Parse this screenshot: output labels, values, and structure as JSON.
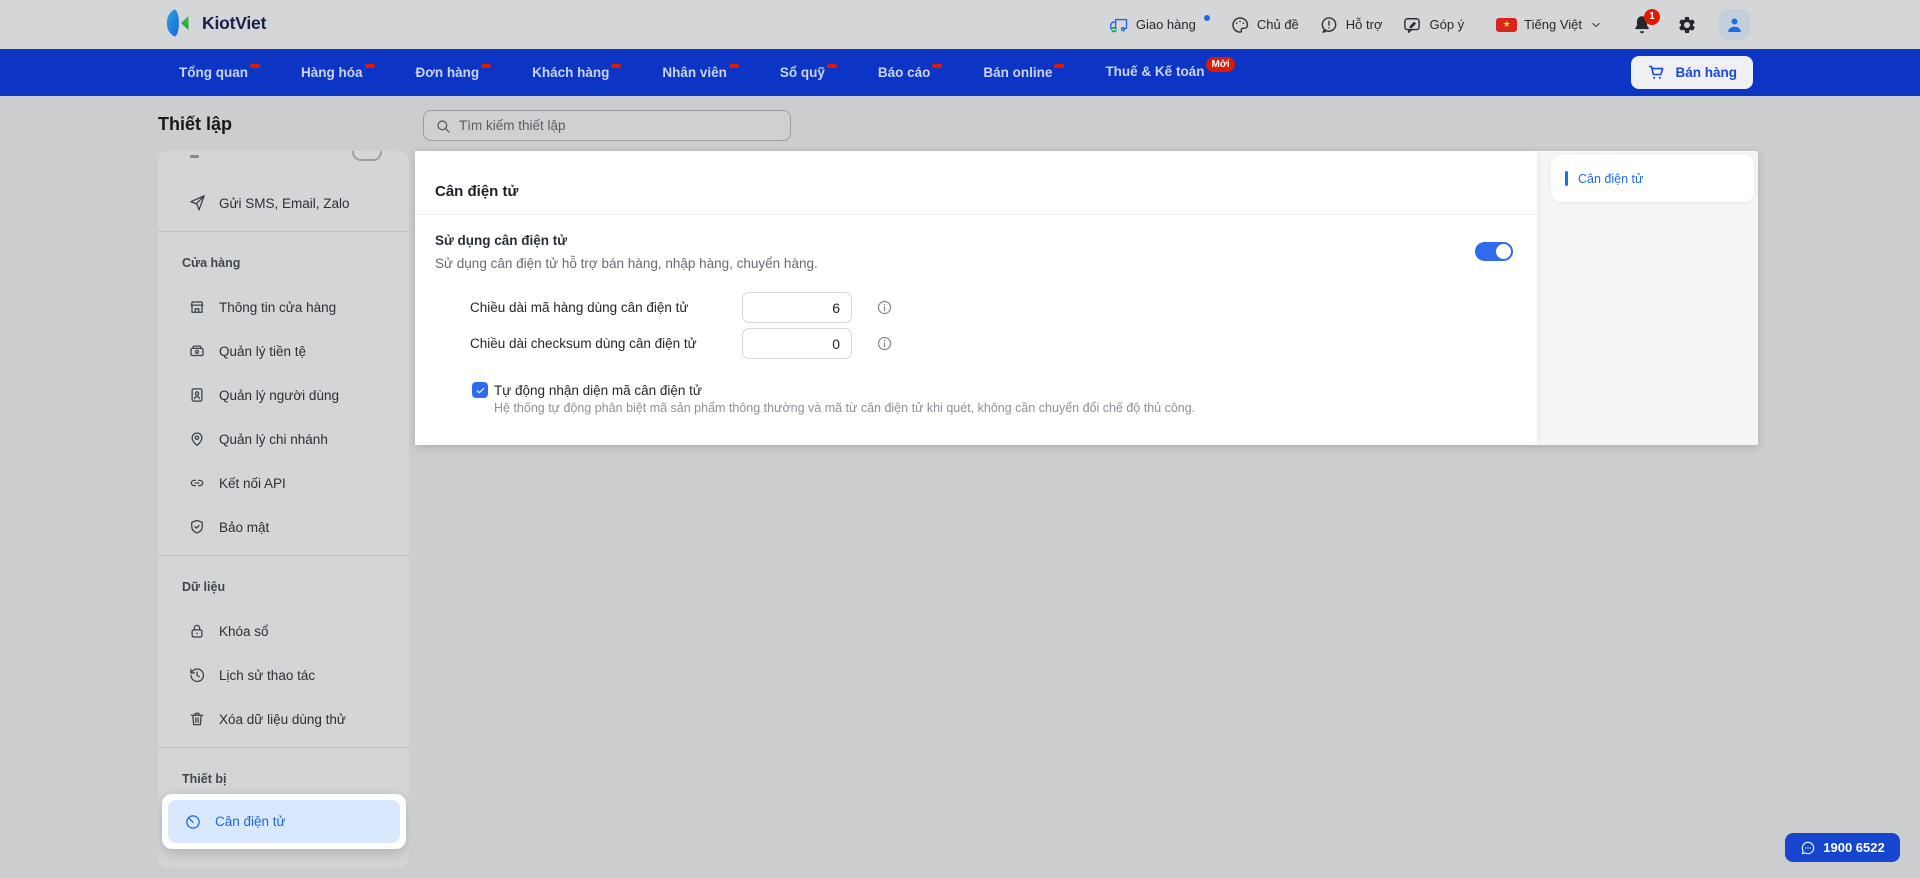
{
  "colors": {
    "nav_blue": "#0c35c5",
    "accent_blue": "#1f6be8",
    "badge_red": "#e11900",
    "selected_item_bg": "#d9e8fc",
    "page_bg": "#cbcdce"
  },
  "topbar": {
    "brand": "KiotViet",
    "items": [
      {
        "label": "Giao hàng",
        "icon": "delivery-truck",
        "dot": true
      },
      {
        "label": "Chủ đề",
        "icon": "palette"
      },
      {
        "label": "Hỗ trợ",
        "icon": "help-bubble"
      },
      {
        "label": "Góp ý",
        "icon": "feedback-bubble"
      }
    ],
    "language": {
      "label": "Tiếng Việt",
      "flag": "vietnam-flag",
      "star": "★"
    },
    "notifications": {
      "count": "1"
    }
  },
  "navbar": {
    "items": [
      {
        "label": "Tổng quan"
      },
      {
        "label": "Hàng hóa"
      },
      {
        "label": "Đơn hàng"
      },
      {
        "label": "Khách hàng"
      },
      {
        "label": "Nhân viên"
      },
      {
        "label": "Sổ quỹ"
      },
      {
        "label": "Báo cáo"
      },
      {
        "label": "Bán online"
      },
      {
        "label": "Thuế & Kế toán",
        "badge": "Mới"
      }
    ],
    "sell_button": {
      "label": "Bán hàng",
      "icon": "cart"
    }
  },
  "page": {
    "title": "Thiết lập",
    "search_placeholder": "Tìm kiếm thiết lập"
  },
  "sidebar": {
    "groups": [
      {
        "items": [
          {
            "icon": "send",
            "label": "Gửi SMS, Email, Zalo"
          }
        ]
      },
      {
        "label": "Cửa hàng",
        "items": [
          {
            "icon": "storefront",
            "label": "Thông tin cửa hàng"
          },
          {
            "icon": "money",
            "label": "Quản lý tiền tệ"
          },
          {
            "icon": "user-card",
            "label": "Quản lý người dùng"
          },
          {
            "icon": "map-pin",
            "label": "Quản lý chi nhánh"
          },
          {
            "icon": "link",
            "label": "Kết nối API"
          },
          {
            "icon": "shield-check",
            "label": "Bảo mật"
          }
        ]
      },
      {
        "label": "Dữ liệu",
        "items": [
          {
            "icon": "lock",
            "label": "Khóa sổ"
          },
          {
            "icon": "history",
            "label": "Lịch sử thao tác"
          },
          {
            "icon": "trash",
            "label": "Xóa dữ liệu dùng thử"
          }
        ]
      },
      {
        "label": "Thiết bị",
        "items": [
          {
            "icon": "scale",
            "label": "Cân điện tử",
            "selected": true,
            "spotlight": true
          }
        ]
      }
    ]
  },
  "settings": {
    "heading": "Cân điện tử",
    "toggle": {
      "label": "Sử dụng cân điện tử",
      "description": "Sử dụng cân điện tử hỗ trợ bán hàng, nhập hàng, chuyển hàng.",
      "enabled": true
    },
    "fields": [
      {
        "label": "Chiều dài mã hàng dùng cân điện tử",
        "value": "6"
      },
      {
        "label": "Chiều dài checksum dùng cân điện tử",
        "value": "0"
      }
    ],
    "auto_detect": {
      "label": "Tự động nhận diện mã cân điện tử",
      "checked": true,
      "description": "Hệ thống tự động phân biệt mã sản phẩm thông thường và mã từ cân điện tử khi quét, không cần chuyển đổi chế độ thủ công."
    },
    "toc": [
      {
        "label": "Cân điện tử",
        "active": true
      }
    ]
  },
  "support": {
    "label": "1900 6522"
  }
}
